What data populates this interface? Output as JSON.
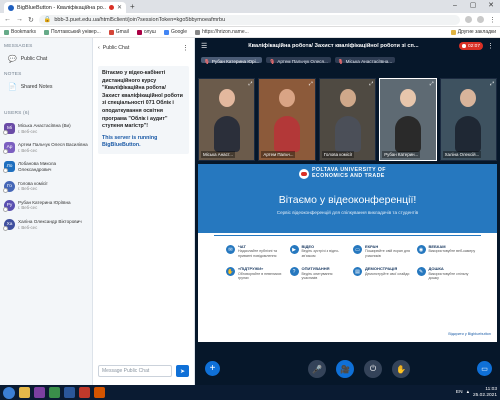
{
  "browser": {
    "tab_title": "BigBlueButton - Кваліфікаційна ро...",
    "new_tab": "+",
    "window_controls": [
      "–",
      "▢",
      "✕"
    ],
    "url": "bbb-3.puet.edu.ua/html5client/join?sessionToken=kgo5bbymoeafmrbu",
    "bookmarks": [
      "Bookmarks",
      "Полтавський універ...",
      "Gmail",
      "олуш",
      "Google",
      "https://hrizon.name..."
    ],
    "other_bookmarks": "Другие закладки"
  },
  "sidebar": {
    "messages_heading": "MESSAGES",
    "public_chat": "Public Chat",
    "notes_heading": "NOTES",
    "shared_notes": "Shared Notes",
    "users_heading": "USERS (6)",
    "users": [
      {
        "initials": "Мі",
        "name": "Міська Анастасіївна (Ви)",
        "sub": "г. Веб-сес",
        "color": "#6a4ba6"
      },
      {
        "initials": "Ар",
        "name": "Артем Пальчук Олеся Василівна",
        "sub": "г. Веб-сес",
        "color": "#7b5fc0"
      },
      {
        "initials": "Ло",
        "name": "Лобанова Микола Олександрович",
        "sub": "",
        "color": "#1e6fbf"
      },
      {
        "initials": "Го",
        "name": "Голова комісії",
        "sub": "г. Веб-сес",
        "color": "#4567b7"
      },
      {
        "initials": "Ру",
        "name": "Рубан Катерина Юріївна",
        "sub": "г. Веб-сес",
        "color": "#5a4fb0"
      },
      {
        "initials": "Ха",
        "name": "Халіна Олександр Вікторович",
        "sub": "г. Веб-сес",
        "color": "#3f4f9e"
      }
    ]
  },
  "chat": {
    "title": "Public Chat",
    "welcome": "Вітаємо у відео-кабінеті дистанційного курсу \"Кваліфікаційна робота/ Захист кваліфікаційної роботи зі спеціальності 071 Облік і оподаткування освітня програма \"Облік і аудит\" ступеня магістр\"!",
    "server_note": "This server is running BigBlueButton.",
    "placeholder": "Message Public Chat",
    "send_icon": "➤"
  },
  "main": {
    "title": "Кваліфікаційна робота/ Захист кваліфікаційної роботи зі сп...",
    "recording": "02:07",
    "talkers": [
      {
        "name": "Рубан Катерина Юрі...",
        "active": true
      },
      {
        "name": "Артем Пальчук Олеся...",
        "active": false
      },
      {
        "name": "Міська Анастасіївна...",
        "active": false
      }
    ],
    "videos": [
      {
        "label": "Міська Анаст...",
        "bg": "#6b5b4b",
        "head": "#e3b89e",
        "body": "#2b2f3a",
        "focus": false
      },
      {
        "label": "Артем Пальч...",
        "bg": "#8c5a3a",
        "head": "#d9a485",
        "body": "#b33838",
        "focus": false
      },
      {
        "label": "Голова комісії",
        "bg": "#4f4a42",
        "head": "#cfa88a",
        "body": "#4b4f58",
        "focus": false
      },
      {
        "label": "Рубан Катерин...",
        "bg": "#5e6a73",
        "head": "#e7c6ac",
        "body": "#2a2a2a",
        "focus": true
      },
      {
        "label": "Халіна Олексій...",
        "bg": "#3e5260",
        "head": "#d8b49b",
        "body": "#1f2834",
        "focus": false
      }
    ],
    "slide": {
      "logo_line1": "POLTAVA UNIVERSITY OF",
      "logo_line2": "ECONOMICS AND TRADE",
      "heading": "Вітаємо у відеоконференції!",
      "subheading": "Сервіс відеоконференцій для спілкування викладачів та студентів",
      "features": [
        {
          "title": "ЧАТ",
          "text": "Надсилайте публічні та приватні повідомлення",
          "icon": "✉"
        },
        {
          "title": "ВІДЕО",
          "text": "Ведіть зустрічі з відео-зв'язком",
          "icon": "▶"
        },
        {
          "title": "ЕКРАН",
          "text": "Поширюйте свій екран для учасників",
          "icon": "▭"
        },
        {
          "title": "ВЕБКАМ",
          "text": "Використовуйте веб-камеру",
          "icon": "◉"
        },
        {
          "title": "«ПІДТРУЖИ»",
          "text": "Обговорюйте в невеликих групах",
          "icon": "✋"
        },
        {
          "title": "ОПИТУВАННЯ",
          "text": "Ведіть опитування учасників",
          "icon": "?"
        },
        {
          "title": "ДЕМОНСТРАЦІЯ",
          "text": "Демонструйте свої слайди",
          "icon": "▤"
        },
        {
          "title": "ДОШКА",
          "text": "Використовуйте спільну дошку",
          "icon": "✎"
        }
      ],
      "footer": "Відкрити у Bigbluebutton"
    },
    "plus": "+",
    "controls": [
      "🎤",
      "🎥",
      "⏻",
      "✋"
    ],
    "presentation_icon": "▭"
  },
  "taskbar": {
    "lang": "EN",
    "time": "11:03",
    "date": "25.02.2021"
  }
}
